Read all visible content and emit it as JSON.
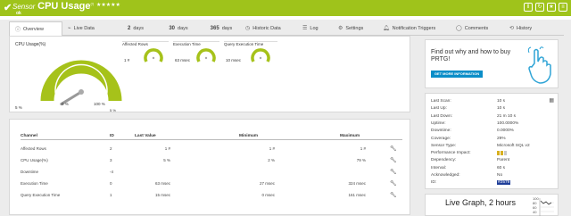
{
  "header": {
    "prefix": "Sensor",
    "title": "CPU Usage",
    "superscript": "(!)",
    "stars": "★★★★★",
    "subtitle": "ok",
    "menu": [
      "Sensor",
      "Overview",
      "Live Data",
      "2 days",
      "30 days"
    ]
  },
  "tabs": [
    {
      "label": "Overview",
      "icon": "info-icon",
      "active": true
    },
    {
      "label": "Live Data",
      "icon": "pulse-icon"
    },
    {
      "label": "2",
      "suffix": "days",
      "icon": ""
    },
    {
      "label": "30",
      "suffix": "days",
      "icon": ""
    },
    {
      "label": "365",
      "suffix": "days",
      "icon": ""
    },
    {
      "label": "Historic Data",
      "icon": "clock-icon"
    },
    {
      "label": "Log",
      "icon": "list-icon"
    },
    {
      "label": "Settings",
      "icon": "gear-icon"
    },
    {
      "label": "Notification Triggers",
      "icon": "bell-icon"
    },
    {
      "label": "Comments",
      "icon": "comment-icon"
    },
    {
      "label": "History",
      "icon": "history-icon"
    }
  ],
  "gauges": {
    "main": {
      "title": "CPU Usage(%)",
      "value": 5,
      "unit": "%",
      "min_label": "0 %",
      "max_label": "100 %",
      "value_label": "5 %",
      "corner_label": "5 %"
    },
    "small": [
      {
        "title": "Affected Rows",
        "value_label": "1 #",
        "level": 0.1
      },
      {
        "title": "Execution Time",
        "value_label": "63 msec",
        "level": 0.2
      },
      {
        "title": "Query Execution Time",
        "value_label": "10 msec",
        "level": 0.1
      }
    ]
  },
  "table": {
    "headers": {
      "channel": "Channel",
      "id": "ID",
      "last": "Last Value",
      "min": "Minimum",
      "max": "Maximum"
    },
    "rows": [
      {
        "channel": "Affected Rows",
        "id": "2",
        "last": "1 #",
        "min": "1 #",
        "max": "1 #"
      },
      {
        "channel": "CPU Usage(%)",
        "id": "3",
        "last": "5 %",
        "min": "2 %",
        "max": "79 %"
      },
      {
        "channel": "Downtime",
        "id": "-4",
        "last": "",
        "min": "",
        "max": ""
      },
      {
        "channel": "Execution Time",
        "id": "0",
        "last": "63 msec",
        "min": "27 msec",
        "max": "324 msec"
      },
      {
        "channel": "Query Execution Time",
        "id": "1",
        "last": "15 msec",
        "min": "0 msec",
        "max": "161 msec"
      }
    ]
  },
  "ad": {
    "text": "Find out why and how to buy PRTG!",
    "button": "GET MORE INFORMATION"
  },
  "info": [
    {
      "k": "Last Scan:",
      "v": "10 s"
    },
    {
      "k": "Last Up:",
      "v": "10 s"
    },
    {
      "k": "Last Down:",
      "v": "21 m 10 s"
    },
    {
      "k": "Uptime:",
      "v": "100.0000%"
    },
    {
      "k": "Downtime:",
      "v": "0.0000%"
    },
    {
      "k": "Coverage:",
      "v": "29%"
    },
    {
      "k": "Sensor Type:",
      "v": "Microsoft SQL v2"
    },
    {
      "k": "Performance Impact:",
      "v": ""
    },
    {
      "k": "Dependency:",
      "v": "Parent"
    },
    {
      "k": "Interval:",
      "v": "60 s"
    },
    {
      "k": "Acknowledged:",
      "v": "No"
    },
    {
      "k": "ID:",
      "v": "#2579"
    }
  ],
  "live": {
    "title": "Live Graph, 2 hours",
    "axis": [
      "100",
      "80",
      "60",
      "40"
    ]
  },
  "colors": {
    "brand": "#9fc31b",
    "accent": "#0b8ec8"
  }
}
